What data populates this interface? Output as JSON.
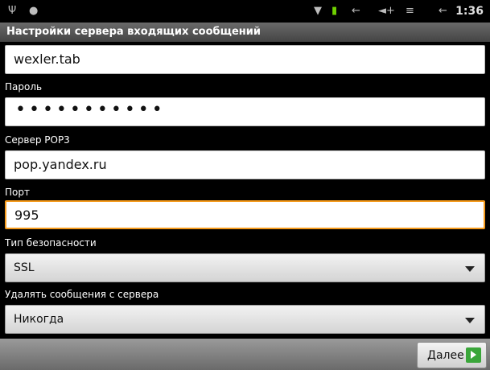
{
  "status_bar": {
    "time": "1:36",
    "icons": [
      "usb-icon",
      "android-icon",
      "wifi-icon",
      "battery-icon",
      "back-nav-icon",
      "volume-icon",
      "menu-icon",
      "home-icon"
    ]
  },
  "title": "Настройки сервера входящих сообщений",
  "fields": {
    "username": {
      "value": "wexler.tab"
    },
    "password": {
      "label": "Пароль",
      "value": "•••••••••••"
    },
    "server": {
      "label": "Сервер POP3",
      "value": "pop.yandex.ru"
    },
    "port": {
      "label": "Порт",
      "value": "995"
    },
    "security": {
      "label": "Тип безопасности",
      "value": "SSL"
    },
    "delete": {
      "label": "Удалять сообщения с сервера",
      "value": "Никогда"
    }
  },
  "next_button": {
    "label": "Далее"
  },
  "colors": {
    "focus": "#f59a1b",
    "next_icon": "#3aa63a"
  }
}
